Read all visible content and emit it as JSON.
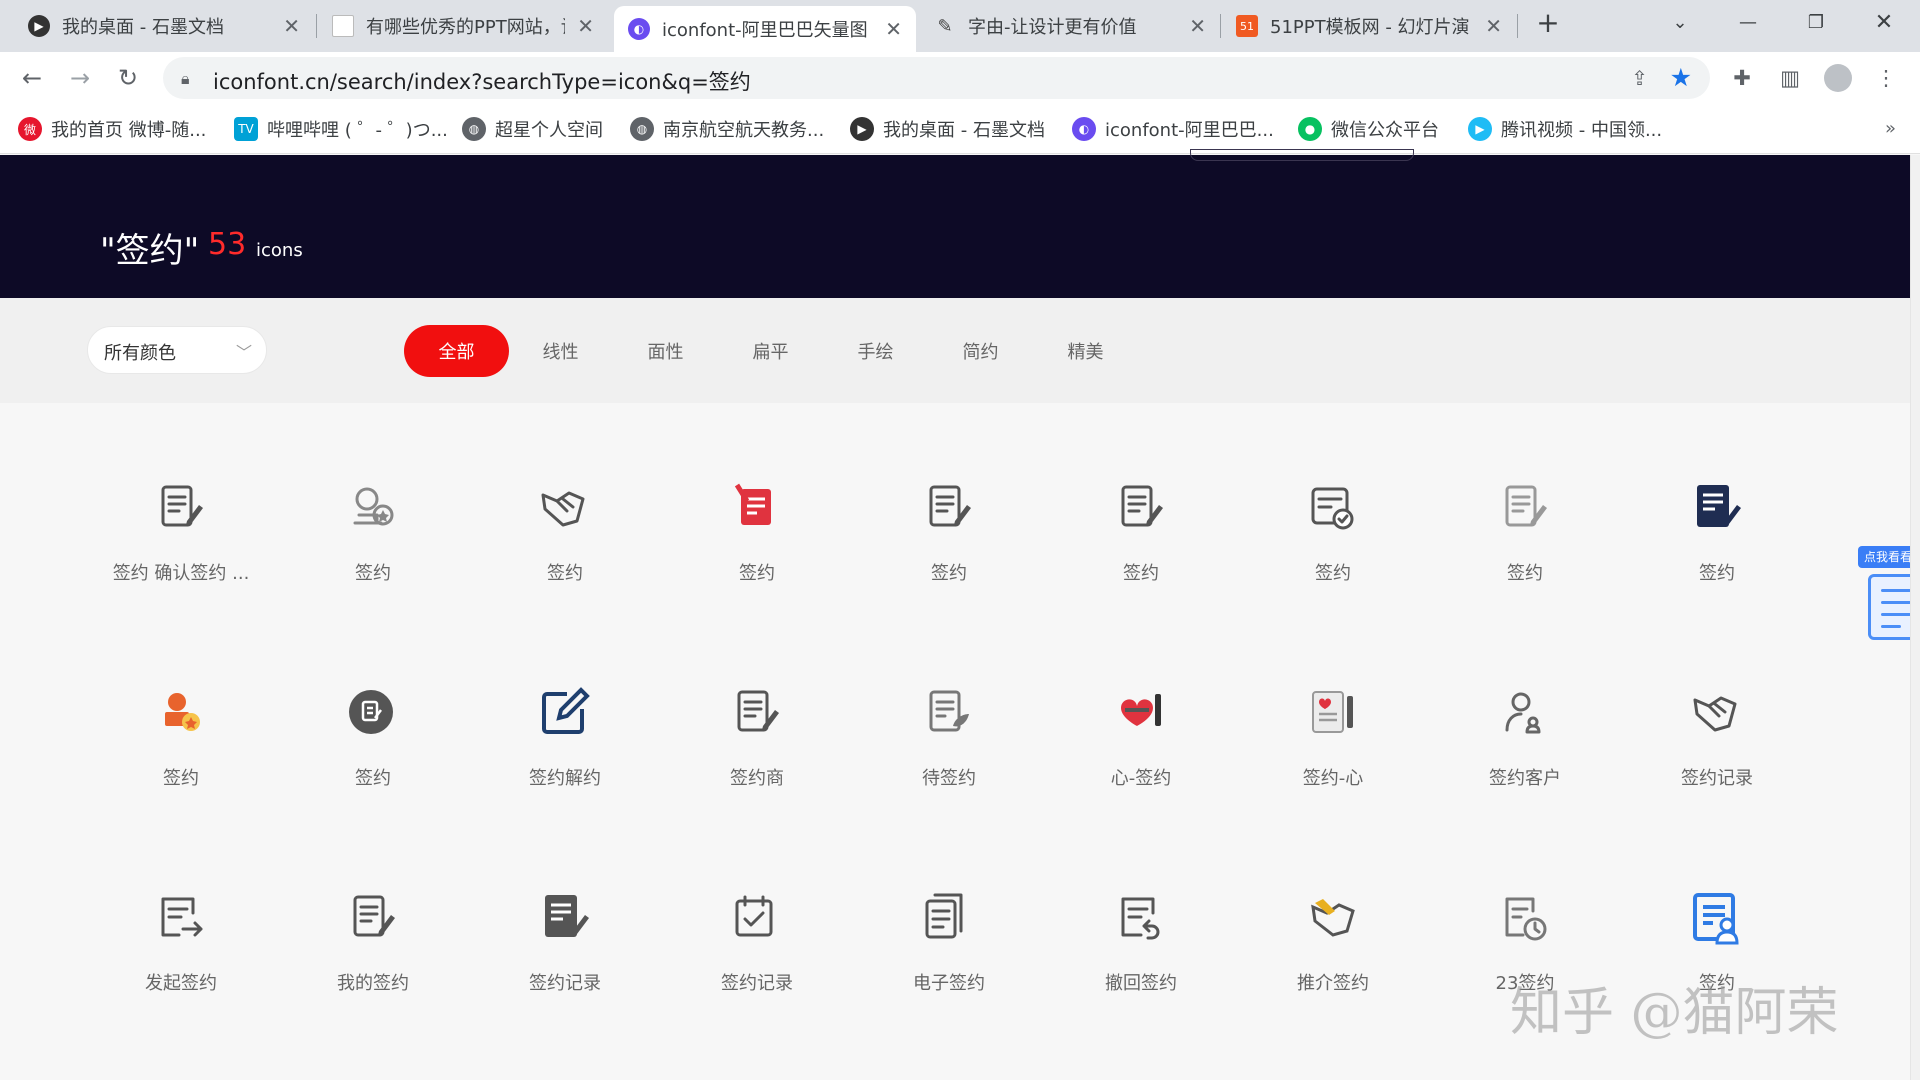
{
  "tabs": [
    {
      "title": "我的桌面 - 石墨文档",
      "icon": "shimo-icon"
    },
    {
      "title": "有哪些优秀的PPT网站，让",
      "icon": "doc-page-icon"
    },
    {
      "title": "iconfont-阿里巴巴矢量图",
      "icon": "iconfont-icon"
    },
    {
      "title": "字由-让设计更有价值",
      "icon": "pen-icon"
    },
    {
      "title": "51PPT模板网 - 幻灯片演",
      "icon": "51ppt-icon"
    }
  ],
  "new_tab_glyph": "+",
  "address_bar": {
    "url": "iconfont.cn/search/index?searchType=icon&q=签约"
  },
  "bookmarks": [
    {
      "label": "我的首页 微博-随...",
      "icon": "weibo-icon"
    },
    {
      "label": "哔哩哔哩 ( ゜- ゜)つ...",
      "icon": "bilibili-icon"
    },
    {
      "label": "超星个人空间",
      "icon": "globe-icon"
    },
    {
      "label": "南京航空航天教务...",
      "icon": "globe-icon"
    },
    {
      "label": "我的桌面 - 石墨文档",
      "icon": "shimo-icon"
    },
    {
      "label": "iconfont-阿里巴巴...",
      "icon": "iconfont-icon"
    },
    {
      "label": "微信公众平台",
      "icon": "wechat-icon"
    },
    {
      "label": "腾讯视频 - 中国领...",
      "icon": "tencent-video-icon"
    }
  ],
  "bookmarks_more": "»",
  "hero": {
    "query": "\"签约\"",
    "count": "53",
    "unit": "icons"
  },
  "color_filter": {
    "value": "所有颜色"
  },
  "style_filters": [
    "全部",
    "线性",
    "面性",
    "扁平",
    "手绘",
    "简约",
    "精美"
  ],
  "active_filter": "全部",
  "icons": [
    {
      "name": "签约 确认签约 ...",
      "glyph": "doc-pen",
      "color": "#555555"
    },
    {
      "name": "签约",
      "glyph": "seal-badge",
      "color": "#888888"
    },
    {
      "name": "签约",
      "glyph": "handshake",
      "color": "#555555"
    },
    {
      "name": "签约",
      "glyph": "red-contract",
      "color": "#e0333f"
    },
    {
      "name": "签约",
      "glyph": "doc-pen",
      "color": "#555555"
    },
    {
      "name": "签约",
      "glyph": "doc-pen",
      "color": "#555555"
    },
    {
      "name": "签约",
      "glyph": "doc-check",
      "color": "#555555"
    },
    {
      "name": "签约",
      "glyph": "doc-pen",
      "color": "#999999"
    },
    {
      "name": "签约",
      "glyph": "doc-pen-solid",
      "color": "#1f2d52"
    },
    {
      "name": "签约",
      "glyph": "seal-orange",
      "color": "#e8632d"
    },
    {
      "name": "签约",
      "glyph": "circle-doc",
      "color": "#555555"
    },
    {
      "name": "签约解约",
      "glyph": "edit-square",
      "color": "#1f3f6e"
    },
    {
      "name": "签约商",
      "glyph": "doc-pen",
      "color": "#555555"
    },
    {
      "name": "待签约",
      "glyph": "doc-leaf",
      "color": "#777777"
    },
    {
      "name": "心-签约",
      "glyph": "heart-pen",
      "color": "#e0333f"
    },
    {
      "name": "签约-心",
      "glyph": "card-heart",
      "color": "#777777"
    },
    {
      "name": "签约客户",
      "glyph": "user-badge",
      "color": "#666666"
    },
    {
      "name": "签约记录",
      "glyph": "handshake",
      "color": "#555555"
    },
    {
      "name": "发起签约",
      "glyph": "doc-arrow",
      "color": "#555555"
    },
    {
      "name": "我的签约",
      "glyph": "doc-pen",
      "color": "#555555"
    },
    {
      "name": "签约记录",
      "glyph": "doc-pen-solid",
      "color": "#555555"
    },
    {
      "name": "签约记录",
      "glyph": "calendar-check",
      "color": "#555555"
    },
    {
      "name": "电子签约",
      "glyph": "doc-stack",
      "color": "#555555"
    },
    {
      "name": "撤回签约",
      "glyph": "doc-undo",
      "color": "#555555"
    },
    {
      "name": "推介签约",
      "glyph": "handshake-yellow",
      "color": "#e8b021"
    },
    {
      "name": "23签约",
      "glyph": "doc-clock",
      "color": "#777777"
    },
    {
      "name": "签约",
      "glyph": "doc-user",
      "color": "#2f7be4"
    }
  ],
  "side_tab": {
    "badge": "点我看看"
  },
  "watermark": "知乎 @猫阿荣"
}
